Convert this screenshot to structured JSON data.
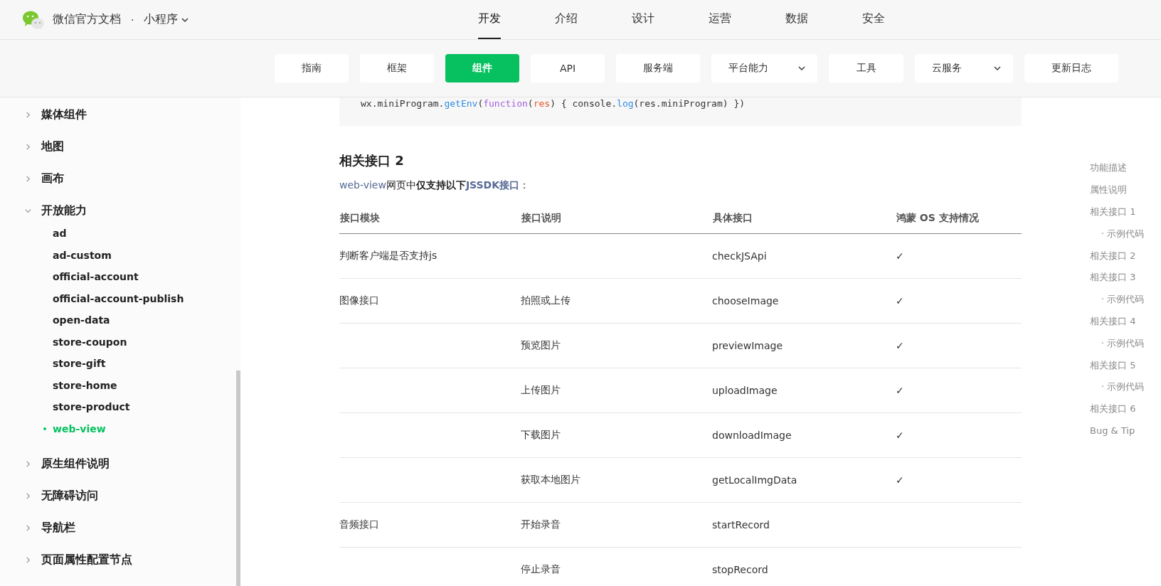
{
  "header": {
    "logo_text": "微信官方文档",
    "separator": "·",
    "product": "小程序",
    "nav": [
      {
        "label": "开发",
        "selected": true
      },
      {
        "label": "介绍",
        "selected": false
      },
      {
        "label": "设计",
        "selected": false
      },
      {
        "label": "运营",
        "selected": false
      },
      {
        "label": "数据",
        "selected": false
      },
      {
        "label": "安全",
        "selected": false
      }
    ]
  },
  "subnav": [
    {
      "label": "指南",
      "selected": false,
      "dropdown": false
    },
    {
      "label": "框架",
      "selected": false,
      "dropdown": false
    },
    {
      "label": "组件",
      "selected": true,
      "dropdown": false
    },
    {
      "label": "API",
      "selected": false,
      "dropdown": false
    },
    {
      "label": "服务端",
      "selected": false,
      "dropdown": false
    },
    {
      "label": "平台能力",
      "selected": false,
      "dropdown": true
    },
    {
      "label": "工具",
      "selected": false,
      "dropdown": false
    },
    {
      "label": "云服务",
      "selected": false,
      "dropdown": true
    },
    {
      "label": "更新日志",
      "selected": false,
      "dropdown": false
    }
  ],
  "sidebar": {
    "items": [
      {
        "label": "媒体组件",
        "expanded": false
      },
      {
        "label": "地图",
        "expanded": false
      },
      {
        "label": "画布",
        "expanded": false
      },
      {
        "label": "开放能力",
        "expanded": true,
        "children": [
          {
            "label": "ad",
            "selected": false
          },
          {
            "label": "ad-custom",
            "selected": false
          },
          {
            "label": "official-account",
            "selected": false
          },
          {
            "label": "official-account-publish",
            "selected": false
          },
          {
            "label": "open-data",
            "selected": false
          },
          {
            "label": "store-coupon",
            "selected": false
          },
          {
            "label": "store-gift",
            "selected": false
          },
          {
            "label": "store-home",
            "selected": false
          },
          {
            "label": "store-product",
            "selected": false
          },
          {
            "label": "web-view",
            "selected": true
          }
        ]
      },
      {
        "label": "原生组件说明",
        "expanded": false
      },
      {
        "label": "无障碍访问",
        "expanded": false
      },
      {
        "label": "导航栏",
        "expanded": false
      },
      {
        "label": "页面属性配置节点",
        "expanded": false
      }
    ]
  },
  "content": {
    "code_tokens": [
      {
        "kind": "plain",
        "text": "wx.miniProgram."
      },
      {
        "kind": "func",
        "text": "getEnv"
      },
      {
        "kind": "plain",
        "text": "("
      },
      {
        "kind": "keyword",
        "text": "function"
      },
      {
        "kind": "plain",
        "text": "("
      },
      {
        "kind": "param",
        "text": "res"
      },
      {
        "kind": "plain",
        "text": ") { console."
      },
      {
        "kind": "func",
        "text": "log"
      },
      {
        "kind": "plain",
        "text": "(res.miniProgram) })"
      }
    ],
    "heading": "相关接口 2",
    "intro": [
      {
        "kind": "link",
        "text": "web-view"
      },
      {
        "kind": "plain",
        "text": "网页中"
      },
      {
        "kind": "bold",
        "text": "仅支持以下"
      },
      {
        "kind": "bold-link",
        "text": "JSSDK接口"
      },
      {
        "kind": "plain",
        "text": "："
      }
    ],
    "table": {
      "columns": [
        "接口模块",
        "接口说明",
        "具体接口",
        "鸿蒙 OS 支持情况"
      ],
      "rows": [
        [
          "判断客户端是否支持js",
          "",
          "checkJSApi",
          "✓"
        ],
        [
          "图像接口",
          "拍照或上传",
          "chooseImage",
          "✓"
        ],
        [
          "",
          "预览图片",
          "previewImage",
          "✓"
        ],
        [
          "",
          "上传图片",
          "uploadImage",
          "✓"
        ],
        [
          "",
          "下载图片",
          "downloadImage",
          "✓"
        ],
        [
          "",
          "获取本地图片",
          "getLocalImgData",
          "✓"
        ],
        [
          "音频接口",
          "开始录音",
          "startRecord",
          ""
        ],
        [
          "",
          "停止录音",
          "stopRecord",
          ""
        ]
      ]
    }
  },
  "toc": [
    {
      "label": "功能描述",
      "kind": "section"
    },
    {
      "label": "属性说明",
      "kind": "section"
    },
    {
      "label": "相关接口 1",
      "kind": "section"
    },
    {
      "label": "· 示例代码",
      "kind": "sub"
    },
    {
      "label": "相关接口 2",
      "kind": "section"
    },
    {
      "label": "相关接口 3",
      "kind": "section"
    },
    {
      "label": "· 示例代码",
      "kind": "sub"
    },
    {
      "label": "相关接口 4",
      "kind": "section"
    },
    {
      "label": "· 示例代码",
      "kind": "sub"
    },
    {
      "label": "相关接口 5",
      "kind": "section"
    },
    {
      "label": "· 示例代码",
      "kind": "sub"
    },
    {
      "label": "相关接口 6",
      "kind": "section"
    },
    {
      "label": "Bug & Tip",
      "kind": "section"
    }
  ]
}
